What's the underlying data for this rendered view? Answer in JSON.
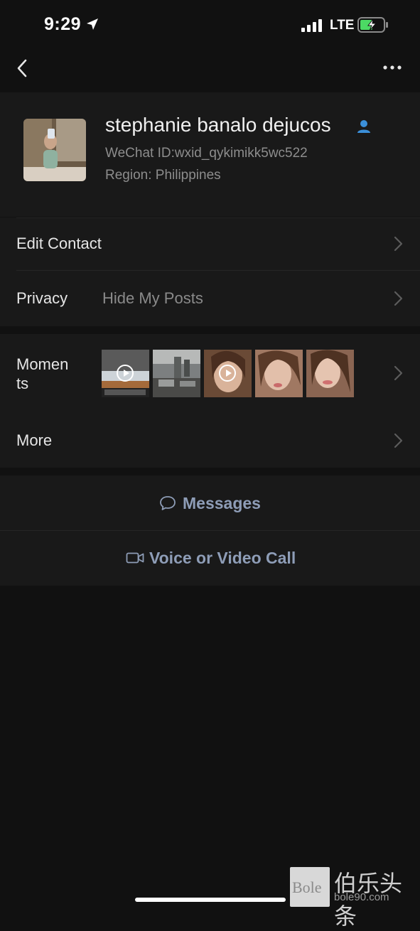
{
  "status_bar": {
    "time": "9:29",
    "network": "LTE"
  },
  "nav": {
    "back_icon": "chevron-left-icon",
    "more_icon": "more-dots-icon"
  },
  "profile": {
    "name": "stephanie banalo dejucos",
    "wechat_id": "WeChat ID:wxid_qykimikk5wc522",
    "region": "Region: Philippines"
  },
  "rows": {
    "edit_contact": "Edit Contact",
    "privacy_label": "Privacy",
    "privacy_value": "Hide My Posts",
    "moments_line1": "Momen",
    "moments_line2": "ts",
    "more": "More"
  },
  "moments_thumbs": [
    {
      "subject": "video-desk-scene",
      "video": true
    },
    {
      "subject": "room-interior",
      "video": false
    },
    {
      "subject": "selfie-video",
      "video": true
    },
    {
      "subject": "selfie-photo",
      "video": false
    },
    {
      "subject": "selfie-photo",
      "video": false
    }
  ],
  "actions": {
    "messages": "Messages",
    "call": "Voice or Video Call"
  },
  "watermark": {
    "brand": "Bole",
    "cn": "伯乐头条",
    "url": "bole90.com"
  },
  "colors": {
    "background": "#111111",
    "panel": "#191919",
    "link": "#8e9db7",
    "battery_charge": "#4cd964",
    "badge": "#3b8fd9"
  }
}
